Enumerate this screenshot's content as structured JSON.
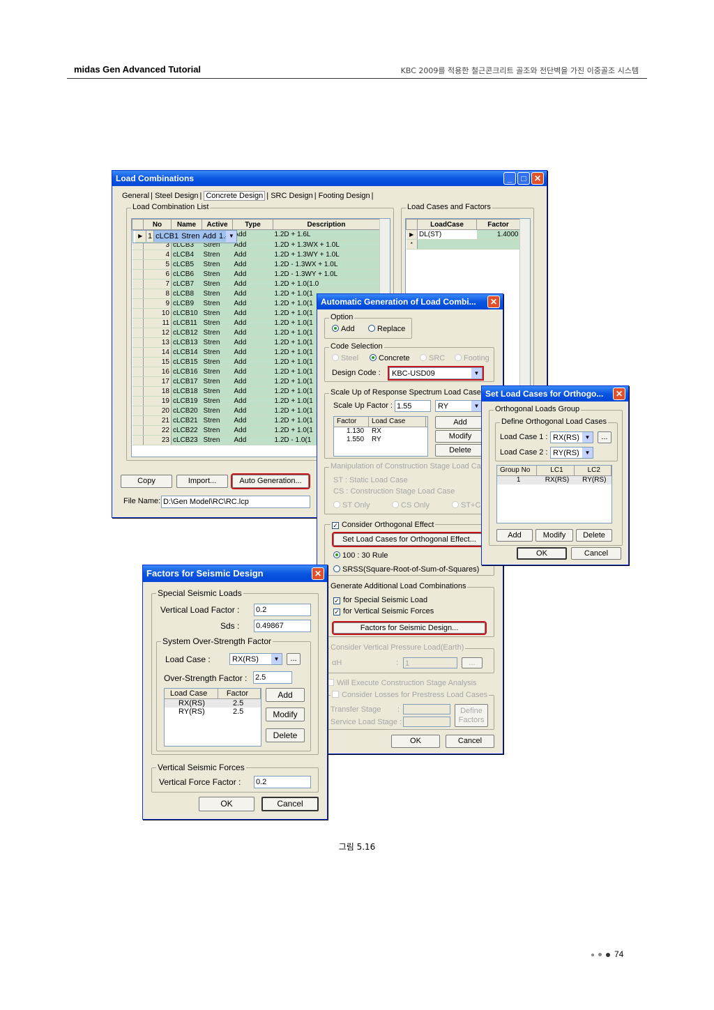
{
  "header": {
    "left": "midas Gen Advanced Tutorial",
    "right": "KBC 2009를 적용한 철근콘크리트 골조와 전단벽을 가진 이중골조 시스템"
  },
  "caption": "그림 5.16",
  "page_number": "74",
  "lc": {
    "title": "Load Combinations",
    "tabs": [
      "General",
      "Steel Design",
      "Concrete Design",
      "SRC Design",
      "Footing Design"
    ],
    "list_title": "Load Combination List",
    "cases_title": "Load Cases and Factors",
    "columns": [
      "No",
      "Name",
      "Active",
      "Type",
      "Description"
    ],
    "rows": [
      {
        "no": "1",
        "name": "cLCB1",
        "active": "Stren",
        "type": "Add",
        "desc": "1.4D"
      },
      {
        "no": "2",
        "name": "cLCB2",
        "active": "Stren",
        "type": "Add",
        "desc": "1.2D + 1.6L"
      },
      {
        "no": "3",
        "name": "cLCB3",
        "active": "Stren",
        "type": "Add",
        "desc": "1.2D + 1.3WX + 1.0L"
      },
      {
        "no": "4",
        "name": "cLCB4",
        "active": "Stren",
        "type": "Add",
        "desc": "1.2D + 1.3WY + 1.0L"
      },
      {
        "no": "5",
        "name": "cLCB5",
        "active": "Stren",
        "type": "Add",
        "desc": "1.2D - 1.3WX + 1.0L"
      },
      {
        "no": "6",
        "name": "cLCB6",
        "active": "Stren",
        "type": "Add",
        "desc": "1.2D - 1.3WY + 1.0L"
      },
      {
        "no": "7",
        "name": "cLCB7",
        "active": "Stren",
        "type": "Add",
        "desc": "1.2D + 1.0(1.0"
      },
      {
        "no": "8",
        "name": "cLCB8",
        "active": "Stren",
        "type": "Add",
        "desc": "1.2D + 1.0(1"
      },
      {
        "no": "9",
        "name": "cLCB9",
        "active": "Stren",
        "type": "Add",
        "desc": "1.2D + 1.0(1"
      },
      {
        "no": "10",
        "name": "cLCB10",
        "active": "Stren",
        "type": "Add",
        "desc": "1.2D + 1.0(1"
      },
      {
        "no": "11",
        "name": "cLCB11",
        "active": "Stren",
        "type": "Add",
        "desc": "1.2D + 1.0(1"
      },
      {
        "no": "12",
        "name": "cLCB12",
        "active": "Stren",
        "type": "Add",
        "desc": "1.2D + 1.0(1"
      },
      {
        "no": "13",
        "name": "cLCB13",
        "active": "Stren",
        "type": "Add",
        "desc": "1.2D + 1.0(1"
      },
      {
        "no": "14",
        "name": "cLCB14",
        "active": "Stren",
        "type": "Add",
        "desc": "1.2D + 1.0(1"
      },
      {
        "no": "15",
        "name": "cLCB15",
        "active": "Stren",
        "type": "Add",
        "desc": "1.2D + 1.0(1"
      },
      {
        "no": "16",
        "name": "cLCB16",
        "active": "Stren",
        "type": "Add",
        "desc": "1.2D + 1.0(1"
      },
      {
        "no": "17",
        "name": "cLCB17",
        "active": "Stren",
        "type": "Add",
        "desc": "1.2D + 1.0(1"
      },
      {
        "no": "18",
        "name": "cLCB18",
        "active": "Stren",
        "type": "Add",
        "desc": "1.2D + 1.0(1"
      },
      {
        "no": "19",
        "name": "cLCB19",
        "active": "Stren",
        "type": "Add",
        "desc": "1.2D + 1.0(1"
      },
      {
        "no": "20",
        "name": "cLCB20",
        "active": "Stren",
        "type": "Add",
        "desc": "1.2D + 1.0(1"
      },
      {
        "no": "21",
        "name": "cLCB21",
        "active": "Stren",
        "type": "Add",
        "desc": "1.2D + 1.0(1"
      },
      {
        "no": "22",
        "name": "cLCB22",
        "active": "Stren",
        "type": "Add",
        "desc": "1.2D + 1.0(1"
      },
      {
        "no": "23",
        "name": "cLCB23",
        "active": "Stren",
        "type": "Add",
        "desc": "1.2D - 1.0(1"
      }
    ],
    "case_columns": [
      "LoadCase",
      "Factor"
    ],
    "case_rows": [
      {
        "case": "DL(ST)",
        "factor": "1.4000"
      }
    ],
    "new_row_marker": "*",
    "btn_copy": "Copy",
    "btn_import": "Import...",
    "btn_auto": "Auto Generation...",
    "file_label": "File Name:",
    "file_value": "D:\\Gen Model\\RC\\RC.lcp"
  },
  "ag": {
    "title": "Automatic Generation of Load Combi...",
    "option_title": "Option",
    "opt_add": "Add",
    "opt_replace": "Replace",
    "code_title": "Code Selection",
    "code_steel": "Steel",
    "code_concrete": "Concrete",
    "code_src": "SRC",
    "code_footing": "Footing",
    "design_code_label": "Design Code :",
    "design_code_value": "KBC-USD09",
    "scale_title": "Scale Up of Response Spectrum Load Cases",
    "scale_factor_label": "Scale Up Factor :",
    "scale_factor_value": "1.55",
    "scale_dir": "RY",
    "scale_columns": [
      "Factor",
      "Load Case"
    ],
    "scale_rows": [
      {
        "f": "1.130",
        "c": "RX"
      },
      {
        "f": "1.550",
        "c": "RY"
      }
    ],
    "btn_add": "Add",
    "btn_modify": "Modify",
    "btn_delete": "Delete",
    "manip_title": "Manipulation of Construction Stage Load Cas",
    "st_text": "ST : Static Load Case",
    "cs_text": "CS : Construction Stage Load Case",
    "st_only": "ST Only",
    "cs_only": "CS Only",
    "st_cs": "ST+CS",
    "orth_check": "Consider Orthogonal Effect",
    "orth_btn": "Set Load Cases for Orthogonal Effect...",
    "rule_100": "100 : 30 Rule",
    "rule_srss": "SRSS(Square-Root-of-Sum-of-Squares)",
    "gen_title": "Generate Additional Load Combinations",
    "gen_special": "for Special Seismic Load",
    "gen_vertical": "for Vertical Seismic Forces",
    "factors_btn": "Factors for Seismic Design...",
    "vert_title": "Consider Vertical Pressure Load(Earth)",
    "alpha_label": "αH",
    "alpha_value": "1",
    "dots": "...",
    "will_exec": "Will Execute Construction Stage Analysis",
    "consider_losses": "Consider Losses for Prestress Load Cases",
    "transfer_label": "Transfer Stage",
    "service_label": "Service Load Stage :",
    "define_factors": "Define Factors",
    "btn_ok": "OK",
    "btn_cancel": "Cancel"
  },
  "orth": {
    "title": "Set Load Cases for Orthogo...",
    "group_title": "Orthogonal Loads Group",
    "define_title": "Define Orthogonal Load Cases",
    "lc1_label": "Load Case 1 :",
    "lc1_value": "RX(RS)",
    "lc2_label": "Load Case 2 :",
    "lc2_value": "RY(RS)",
    "dots": "...",
    "columns": [
      "Group No",
      "LC1",
      "LC2"
    ],
    "rows": [
      {
        "g": "1",
        "a": "RX(RS)",
        "b": "RY(RS)"
      }
    ],
    "btn_add": "Add",
    "btn_modify": "Modify",
    "btn_delete": "Delete",
    "btn_ok": "OK",
    "btn_cancel": "Cancel"
  },
  "fsd": {
    "title": "Factors for Seismic Design",
    "special_title": "Special Seismic Loads",
    "vlf_label": "Vertical Load Factor :",
    "vlf_value": "0.2",
    "sds_label": "Sds :",
    "sds_value": "0.49867",
    "sos_title": "System Over-Strength Factor",
    "lc_label": "Load Case :",
    "lc_value": "RX(RS)",
    "dots": "...",
    "osf_label": "Over-Strength Factor :",
    "osf_value": "2.5",
    "columns": [
      "Load Case",
      "Factor"
    ],
    "rows": [
      {
        "c": "RX(RS)",
        "f": "2.5"
      },
      {
        "c": "RY(RS)",
        "f": "2.5"
      }
    ],
    "btn_add": "Add",
    "btn_modify": "Modify",
    "btn_delete": "Delete",
    "vsf_title": "Vertical Seismic Forces",
    "vff_label": "Vertical Force Factor :",
    "vff_value": "0.2",
    "btn_ok": "OK",
    "btn_cancel": "Cancel"
  },
  "colors": {
    "title_bar": "#0a55e0",
    "highlight_red": "#c4161c",
    "grid_green": "#bfe0c6",
    "grid_selected": "#9ec1f0"
  }
}
